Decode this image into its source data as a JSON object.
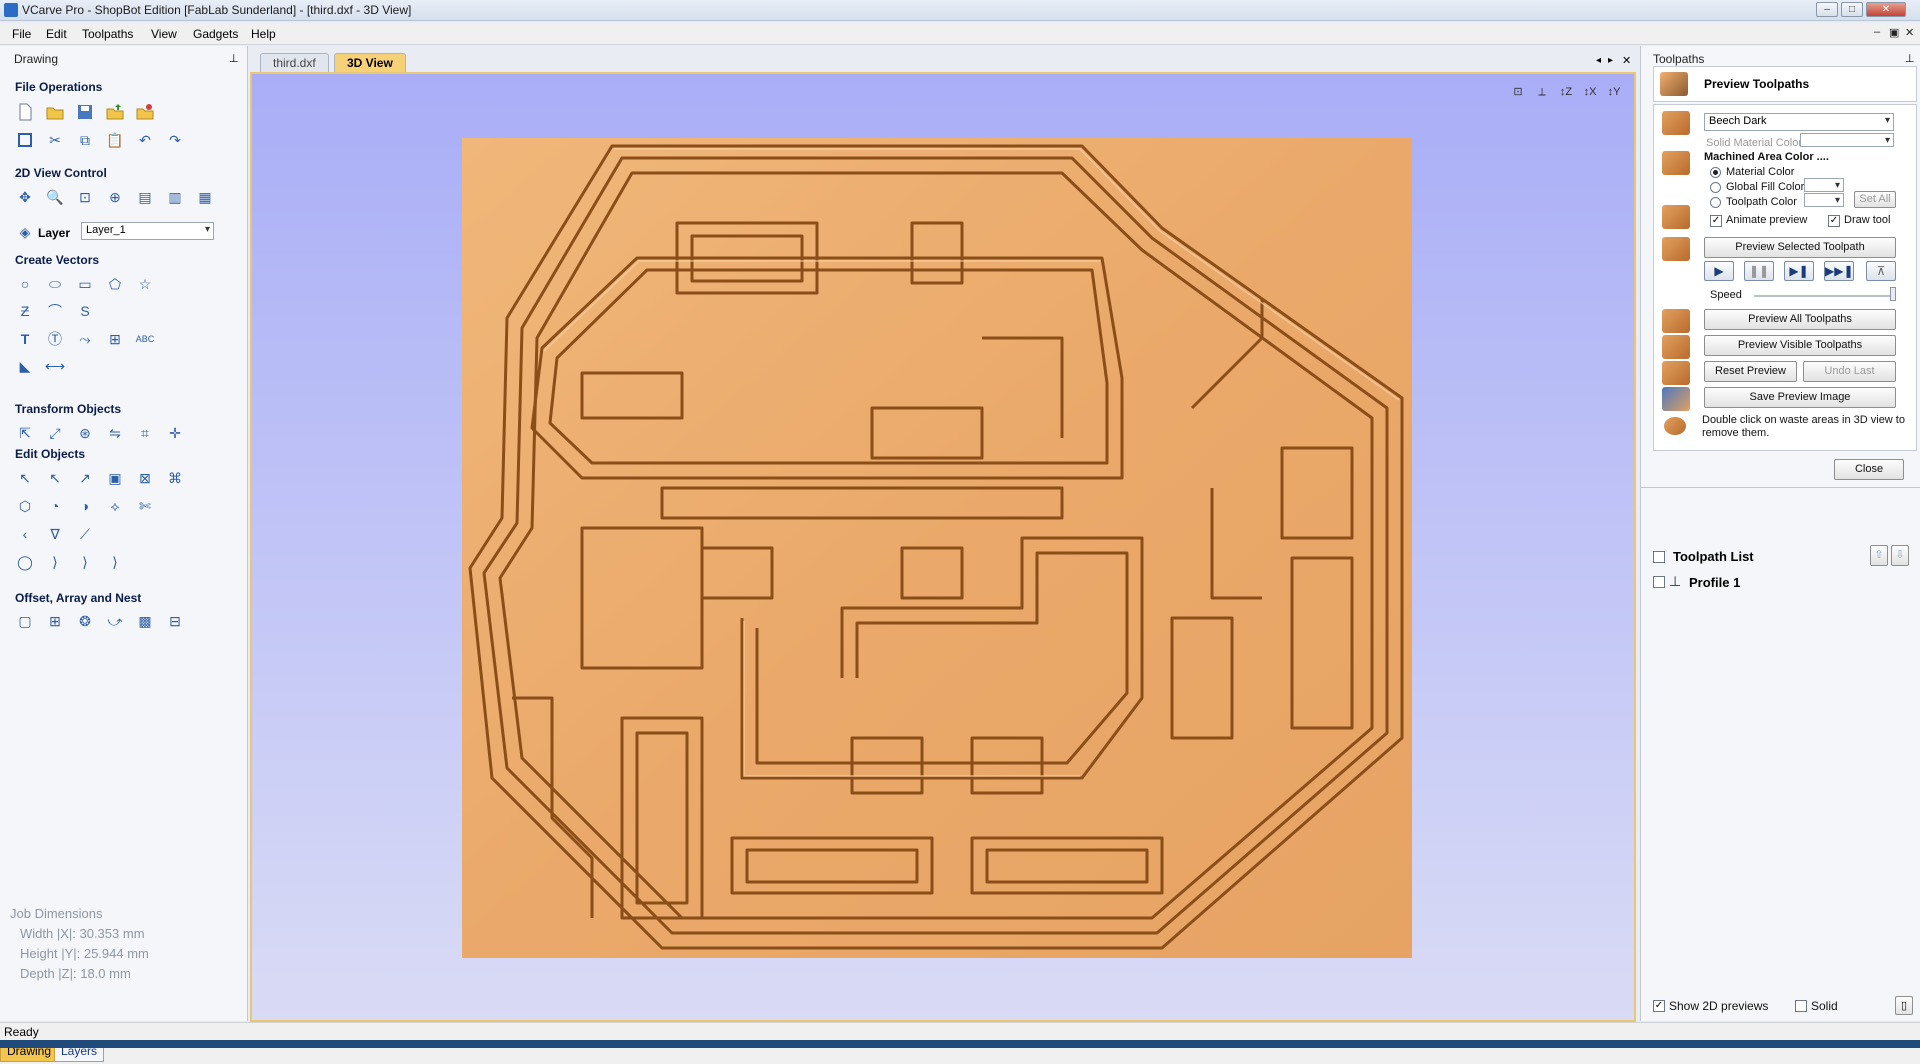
{
  "window": {
    "title": "VCarve Pro - ShopBot Edition [FabLab Sunderland] - [third.dxf - 3D View]"
  },
  "menu": [
    "File",
    "Edit",
    "Toolpaths",
    "View",
    "Gadgets",
    "Help"
  ],
  "left_panel": {
    "header": "Drawing",
    "sections": {
      "file_ops": "File Operations",
      "view_2d": "2D View Control",
      "create_vectors": "Create Vectors",
      "transform": "Transform Objects",
      "edit_objects": "Edit Objects",
      "offset": "Offset, Array and Nest"
    },
    "layer_label": "Layer",
    "layer_value": "Layer_1",
    "job_dims": {
      "title": "Job Dimensions",
      "width": "Width  |X|: 30.353 mm",
      "height": "Height |Y|: 25.944 mm",
      "depth": "Depth  |Z|: 18.0 mm"
    },
    "tabs": [
      "Drawing",
      "Layers"
    ]
  },
  "doc_tabs": [
    "third.dxf",
    "3D View"
  ],
  "right_panel": {
    "header": "Toolpaths",
    "preview_title": "Preview Toolpaths",
    "material": "Beech Dark",
    "solid_material_color": "Solid Material Color",
    "machined_area": "Machined Area Color ....",
    "radios": [
      "Material Color",
      "Global Fill Color",
      "Toolpath Color"
    ],
    "set_all": "Set All",
    "animate_preview": "Animate preview",
    "draw_tool": "Draw tool",
    "preview_selected": "Preview Selected Toolpath",
    "speed": "Speed",
    "preview_all": "Preview All Toolpaths",
    "preview_visible": "Preview Visible Toolpaths",
    "reset_preview": "Reset Preview",
    "undo_last": "Undo Last",
    "save_preview": "Save Preview Image",
    "hint": "Double click on waste areas in 3D view to remove them.",
    "close": "Close",
    "toolpath_list": "Toolpath List",
    "toolpaths": [
      "Profile 1"
    ],
    "show_2d": "Show 2D previews",
    "solid": "Solid"
  },
  "status": "Ready",
  "colors": {
    "wood": "#e8a867",
    "view_bg": "#a9aef7",
    "accent": "#e7c776"
  }
}
